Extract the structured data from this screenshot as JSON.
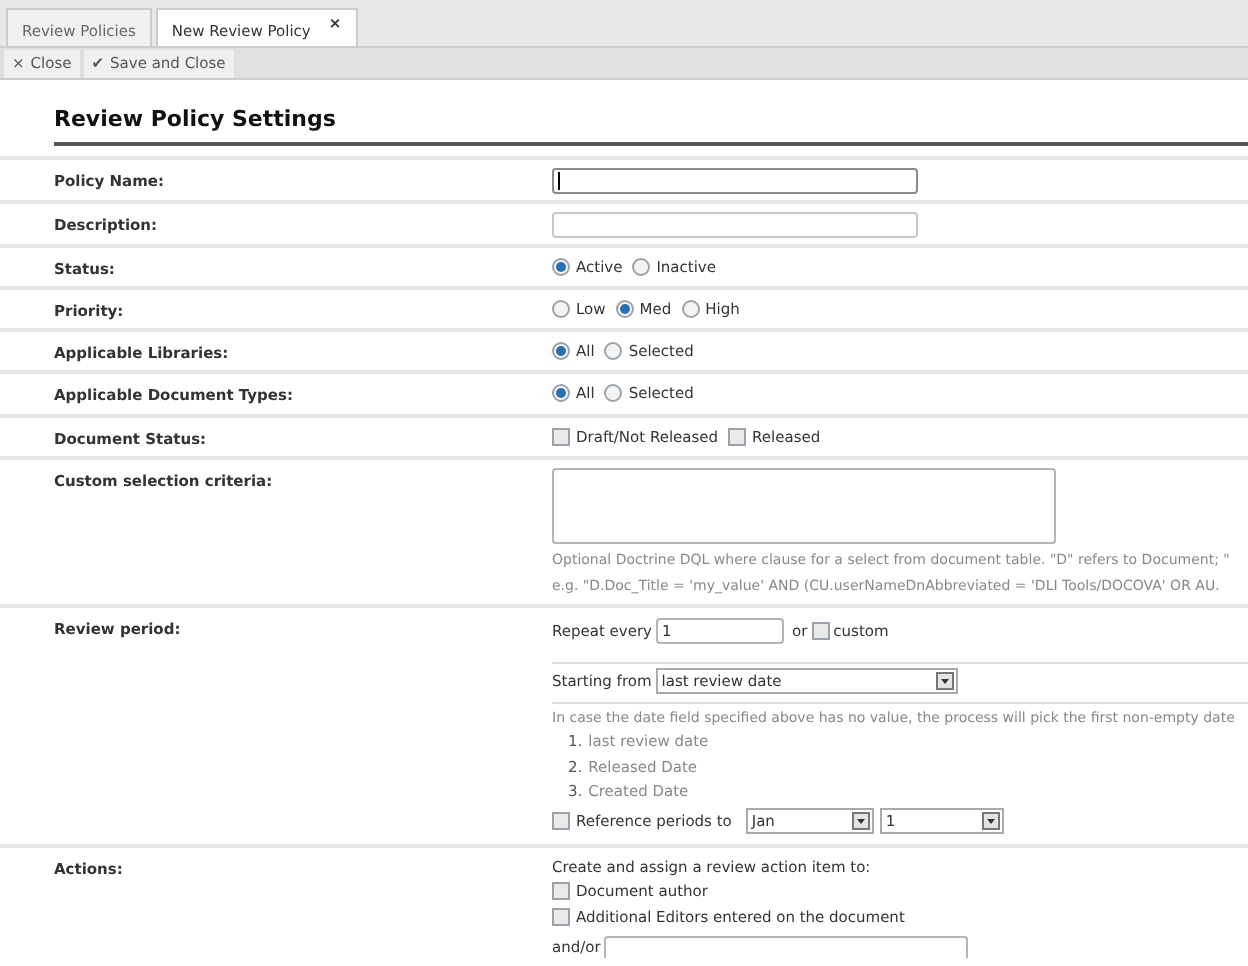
{
  "tabs": [
    {
      "label": "Review Policies",
      "selected": false
    },
    {
      "label": "New Review Policy",
      "selected": true,
      "close_glyph": "×"
    }
  ],
  "toolbar": [
    {
      "glyph": "×",
      "label": "Close"
    },
    {
      "glyph": "✔",
      "label": "Save and Close"
    }
  ],
  "section_title": "Review Policy Settings",
  "fields": [
    {
      "kind": "text",
      "label": "Policy Name:",
      "focused": true
    },
    {
      "kind": "text",
      "label": "Description:",
      "focused": false
    },
    {
      "kind": "radio",
      "label": "Status:",
      "options": [
        {
          "label": "Active",
          "selected": true
        },
        {
          "label": "Inactive",
          "selected": false
        }
      ]
    },
    {
      "kind": "radio",
      "label": "Priority:",
      "options": [
        {
          "label": "Low",
          "selected": false
        },
        {
          "label": "Med",
          "selected": true
        },
        {
          "label": "High",
          "selected": false
        }
      ]
    },
    {
      "kind": "radio",
      "label": "Applicable Libraries:",
      "options": [
        {
          "label": "All",
          "selected": true
        },
        {
          "label": "Selected",
          "selected": false
        }
      ]
    },
    {
      "kind": "radio",
      "label": "Applicable Document Types:",
      "options": [
        {
          "label": "All",
          "selected": true
        },
        {
          "label": "Selected",
          "selected": false
        }
      ]
    },
    {
      "kind": "checkbox",
      "label": "Document Status:",
      "options": [
        {
          "label": "Draft/Not Released",
          "checked": false
        },
        {
          "label": "Released",
          "checked": false
        }
      ]
    },
    {
      "kind": "textarea",
      "label": "Custom selection criteria:",
      "hints": [
        "Optional Doctrine DQL where clause for a select from document table. \"D\" refers to Document; \"",
        "e.g. \"D.Doc_Title = 'my_value' AND (CU.userNameDnAbbreviated = 'DLI Tools/DOCOVA' OR AU."
      ]
    },
    {
      "kind": "review_period",
      "label": "Review period:",
      "repeat": {
        "label": "Repeat every",
        "value": "1",
        "or_label": "or",
        "custom": {
          "label": "custom",
          "checked": false
        }
      },
      "starting": {
        "label": "Starting from",
        "value": "last review date"
      },
      "hint": "In case the date field specified above has no value, the process will pick the first non-empty date",
      "fallbacks": [
        {
          "number": "1.",
          "label": "last review date"
        },
        {
          "number": "2.",
          "label": "Released Date"
        },
        {
          "number": "3.",
          "label": "Created Date"
        }
      ],
      "reference": {
        "label": "Reference periods to",
        "checked": false,
        "month": "Jan",
        "day": "1"
      }
    },
    {
      "kind": "actions",
      "label": "Actions:",
      "intro": "Create and assign a review action item to:",
      "options": [
        {
          "label": "Document author",
          "checked": false
        },
        {
          "label": "Additional Editors entered on the document",
          "checked": false
        }
      ],
      "and_or": {
        "label": "and/or"
      }
    }
  ]
}
